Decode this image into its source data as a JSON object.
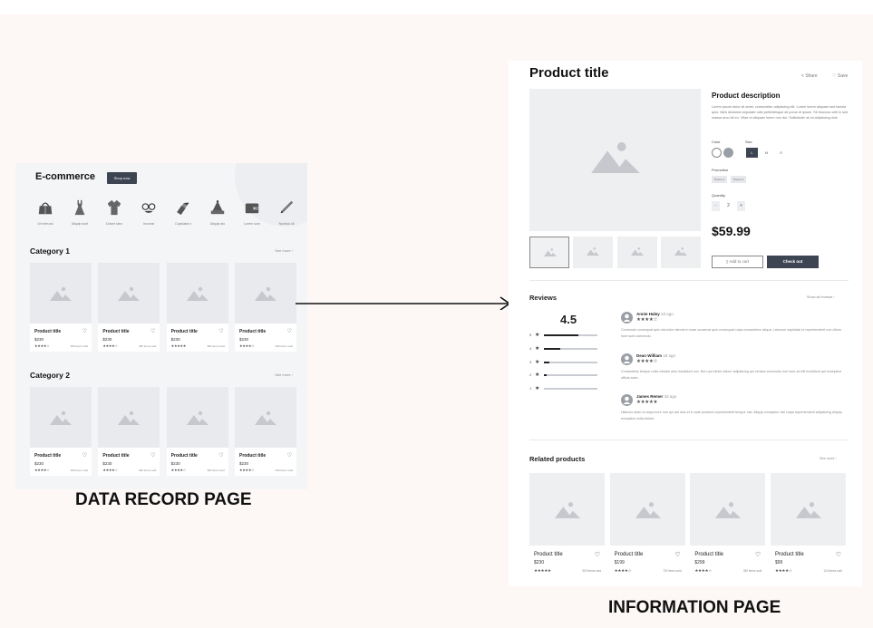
{
  "colors": {
    "page_bg": "#fdf8f6",
    "dark_button": "#3d4452",
    "placeholder": "#e9eaed"
  },
  "left_page": {
    "title": "E-commerce",
    "shop_button": "Shop now",
    "category_icons": [
      {
        "icon": "handbag-icon",
        "label": "Ut enim ad"
      },
      {
        "icon": "dress-icon",
        "label": "Aliquip sunt"
      },
      {
        "icon": "shirt-icon",
        "label": "Dolore labo"
      },
      {
        "icon": "glasses-icon",
        "label": "Incurrat"
      },
      {
        "icon": "lipstick-icon",
        "label": "Cupidatat n"
      },
      {
        "icon": "hat-icon",
        "label": "Aliquip alo"
      },
      {
        "icon": "wallet-icon",
        "label": "Lorem sum"
      },
      {
        "icon": "pen-icon",
        "label": "Nostrud ull"
      }
    ],
    "categories": [
      {
        "name": "Category 1",
        "see_more": "See more",
        "products": [
          {
            "title": "Product title",
            "price": "$230",
            "stars": "★★★★☆",
            "sold": "390 items sold"
          },
          {
            "title": "Product title",
            "price": "$230",
            "stars": "★★★★☆",
            "sold": "390 items sold"
          },
          {
            "title": "Product title",
            "price": "$230",
            "stars": "★★★★★",
            "sold": "390 items sold"
          },
          {
            "title": "Product title",
            "price": "$230",
            "stars": "★★★★☆",
            "sold": "390 items sold"
          }
        ]
      },
      {
        "name": "Category 2",
        "see_more": "See more",
        "products": [
          {
            "title": "Product title",
            "price": "$230",
            "stars": "★★★★☆",
            "sold": "390 items sold"
          },
          {
            "title": "Product title",
            "price": "$230",
            "stars": "★★★★☆",
            "sold": "390 items sold"
          },
          {
            "title": "Product title",
            "price": "$230",
            "stars": "★★★★☆",
            "sold": "390 items sold"
          },
          {
            "title": "Product title",
            "price": "$230",
            "stars": "★★★★☆",
            "sold": "390 items sold"
          }
        ]
      }
    ],
    "caption": "DATA RECORD PAGE"
  },
  "right_page": {
    "title": "Product title",
    "share": "Share",
    "save": "Save",
    "description_title": "Product description",
    "description": "Lorem ipsum dolor sit amet, consectetur adipiscing elit. Lorem lorem aliquam sed lacinia quis. Nibh dictumst vulputate odio pellentesque sit purus et ipsum. Sit rhoncus velit in sed massa arcu sit eu. Vitae et aliquam lorem non dui. Sollicitudin at mi adipiscing duis.",
    "color_label": "Color",
    "colors": [
      "#ffffff",
      "#9a9ea6"
    ],
    "size_label": "Size",
    "sizes": [
      "L",
      "M",
      "S"
    ],
    "selected_size": "L",
    "promotion_label": "Promotion",
    "promotions": [
      "Promo 1",
      "Promo 2"
    ],
    "quantity_label": "Quantity",
    "quantity": "2",
    "minus": "-",
    "plus": "+",
    "price": "$59.99",
    "add_to_cart": "Add to cart",
    "check_out": "Check out",
    "reviews_title": "Reviews",
    "show_all_reviews": "Show all reviews",
    "rating": "4.5",
    "rating_bars": [
      {
        "stars": "5",
        "fraction": 0.65
      },
      {
        "stars": "4",
        "fraction": 0.3
      },
      {
        "stars": "3",
        "fraction": 0.1
      },
      {
        "stars": "2",
        "fraction": 0.05
      },
      {
        "stars": "1",
        "fraction": 0.0
      }
    ],
    "reviews": [
      {
        "name": "Annie Haley",
        "ago": "2d ago",
        "stars": "★★★★☆",
        "text": "Commodo consequat quis nisi dolor laboris in esse occaecat quis consequat culpa consectetur aliqua. Laborum cupidatat ut reprehenderit non cillum irure sunt commodo."
      },
      {
        "name": "Dean William",
        "ago": "4d ago",
        "stars": "★★★★☆",
        "text": "Consectetur tempor nulla veniam duis incididunt non. Non qui minim dolore adipisicing qui veniam commodo non irure ad elit incididunt qui excepteur officia anim."
      },
      {
        "name": "James Remer",
        "ago": "3d ago",
        "stars": "★★★★★",
        "text": "Ullamco anim ut culpa irure non qui aut duis et in aute proident reprehenderit tempor nisi. Aliquip excepteur nisi culpa reprehenderit adipisicing aliquip excepteur nulla dolore."
      }
    ],
    "related_title": "Related products",
    "related_see_more": "See more",
    "related": [
      {
        "title": "Product title",
        "price": "$230",
        "stars": "★★★★★",
        "sold": "500 items sold"
      },
      {
        "title": "Product title",
        "price": "$199",
        "stars": "★★★★☆",
        "sold": "700 items sold"
      },
      {
        "title": "Product title",
        "price": "$299",
        "stars": "★★★★☆",
        "sold": "350 items sold"
      },
      {
        "title": "Product title",
        "price": "$99",
        "stars": "★★★★☆",
        "sold": "124 items sold"
      }
    ],
    "caption": "INFORMATION  PAGE"
  }
}
